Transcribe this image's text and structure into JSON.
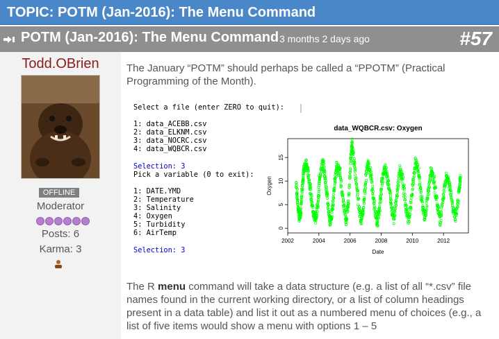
{
  "topic": {
    "title": "TOPIC: POTM (Jan-2016): The Menu Command"
  },
  "post": {
    "title": "POTM (Jan-2016): The Menu Command",
    "time_ago": "3 months 2 days ago",
    "number": "#57"
  },
  "author": {
    "username": "Todd.OBrien",
    "status": "OFFLINE",
    "role": "Moderator",
    "posts": "Posts: 6",
    "karma": "Karma: 3"
  },
  "content": {
    "intro": "The January “POTM” should perhaps be called a “PPOTM” (Practical Programming of the Month).",
    "body_pre": "The R ",
    "body_bold": "menu",
    "body_post": " command will take a data structure (e.g. a list of all “*.csv” file names found in the current working directory, or a list of column headings present in a data table) and list it out as a numbered menu of choices (e.g., a list of five items would show a menu with options 1 – 5"
  },
  "console": {
    "prompt1": "Select a file (enter ZERO to quit):",
    "files": [
      "1: data_ACEBB.csv",
      "2: data_ELKNM.csv",
      "3: data_NOCRC.csv",
      "4: data_WQBCR.csv"
    ],
    "selection1": "Selection: 3",
    "prompt2": "Pick a variable (0 to exit):",
    "variables": [
      "1: DATE.YMD",
      "2: Temperature",
      "3: Salinity",
      "4: Oxygen",
      "5: Turbidity",
      "6: AirTemp"
    ],
    "selection2": "Selection: 3"
  },
  "colors": {
    "topic_bar": "#4a87c9",
    "post_header": "#8f8f8f",
    "username": "#8b1a1a",
    "points": "#00ff00",
    "selection_text": "#0000cc"
  },
  "chart_data": {
    "type": "scatter",
    "title": "data_WQBCR.csv:  Oxygen",
    "xlabel": "Date",
    "ylabel": "Oxygen",
    "xlim": [
      2002.0,
      2013.6
    ],
    "ylim": [
      -1,
      19
    ],
    "xticks": [
      "2002",
      "2004",
      "2006",
      "2008",
      "2010",
      "2012"
    ],
    "yticks": [
      "0",
      "5",
      "10",
      "15"
    ],
    "series": [
      {
        "color": "#00ff00",
        "cycle": [
          {
            "x": 2002.55,
            "y": 9.5
          },
          {
            "x": 2002.65,
            "y": 5
          },
          {
            "x": 2002.75,
            "y": 2
          },
          {
            "x": 2002.85,
            "y": 4
          },
          {
            "x": 2002.95,
            "y": 9
          },
          {
            "x": 2003.05,
            "y": 13
          },
          {
            "x": 2003.2,
            "y": 13.5
          },
          {
            "x": 2003.35,
            "y": 11
          },
          {
            "x": 2003.5,
            "y": 7
          },
          {
            "x": 2003.65,
            "y": 3
          },
          {
            "x": 2003.8,
            "y": 2
          },
          {
            "x": 2003.95,
            "y": 5.5
          },
          {
            "x": 2004.05,
            "y": 11
          },
          {
            "x": 2004.25,
            "y": 14
          },
          {
            "x": 2004.4,
            "y": 11
          },
          {
            "x": 2004.55,
            "y": 6
          },
          {
            "x": 2004.7,
            "y": 1.5
          },
          {
            "x": 2004.85,
            "y": 3
          },
          {
            "x": 2005.0,
            "y": 9
          },
          {
            "x": 2005.15,
            "y": 13
          },
          {
            "x": 2005.35,
            "y": 12
          },
          {
            "x": 2005.55,
            "y": 6
          },
          {
            "x": 2005.75,
            "y": 1.5
          },
          {
            "x": 2005.9,
            "y": 6
          },
          {
            "x": 2006.05,
            "y": 15
          },
          {
            "x": 2006.15,
            "y": 18
          },
          {
            "x": 2006.3,
            "y": 13
          },
          {
            "x": 2006.5,
            "y": 7
          },
          {
            "x": 2006.7,
            "y": 1.5
          },
          {
            "x": 2006.85,
            "y": 4
          },
          {
            "x": 2007.0,
            "y": 10
          },
          {
            "x": 2007.15,
            "y": 14.5
          },
          {
            "x": 2007.35,
            "y": 11
          },
          {
            "x": 2007.55,
            "y": 5
          },
          {
            "x": 2007.75,
            "y": 1
          },
          {
            "x": 2007.9,
            "y": 4
          },
          {
            "x": 2008.05,
            "y": 10
          },
          {
            "x": 2008.25,
            "y": 13
          },
          {
            "x": 2008.45,
            "y": 10
          },
          {
            "x": 2008.65,
            "y": 5
          },
          {
            "x": 2008.8,
            "y": 2
          },
          {
            "x": 2009.0,
            "y": 7
          },
          {
            "x": 2009.2,
            "y": 12.5
          },
          {
            "x": 2009.4,
            "y": 10
          },
          {
            "x": 2009.6,
            "y": 4
          },
          {
            "x": 2009.8,
            "y": 1.5
          },
          {
            "x": 2010.0,
            "y": 8
          },
          {
            "x": 2010.2,
            "y": 14
          },
          {
            "x": 2010.4,
            "y": 12
          },
          {
            "x": 2010.6,
            "y": 6
          },
          {
            "x": 2010.8,
            "y": 2
          },
          {
            "x": 2011.0,
            "y": 7
          },
          {
            "x": 2011.2,
            "y": 12
          },
          {
            "x": 2011.4,
            "y": 10
          },
          {
            "x": 2011.6,
            "y": 5
          },
          {
            "x": 2011.8,
            "y": 1.5
          },
          {
            "x": 2012.0,
            "y": 7
          },
          {
            "x": 2012.2,
            "y": 11.5
          },
          {
            "x": 2012.4,
            "y": 9
          },
          {
            "x": 2012.6,
            "y": 4
          },
          {
            "x": 2012.8,
            "y": 2
          },
          {
            "x": 2013.0,
            "y": 8
          },
          {
            "x": 2013.1,
            "y": 11
          }
        ],
        "spread": 2.2
      }
    ]
  }
}
